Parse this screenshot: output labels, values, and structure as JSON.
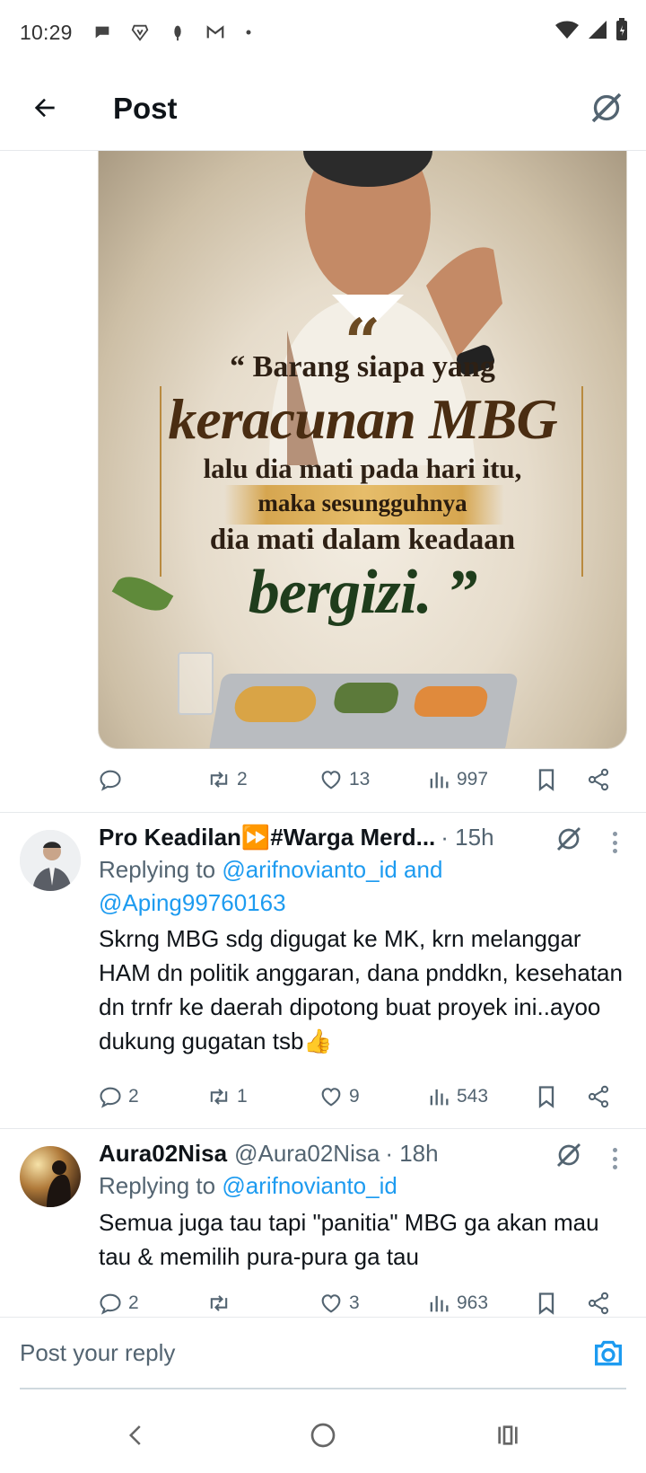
{
  "status_bar": {
    "time": "10:29",
    "icons_left": [
      "chat-icon",
      "brave-icon",
      "notification-icon",
      "gmail-icon",
      "dot-icon"
    ],
    "icons_right": [
      "wifi-icon",
      "signal-icon",
      "battery-icon"
    ]
  },
  "header": {
    "title": "Post",
    "back_icon": "arrow-left-icon",
    "grok_icon": "grok-icon"
  },
  "post": {
    "image_text": {
      "open_quote": "“",
      "line1": "“ Barang siapa yang",
      "line2": "keracunan MBG",
      "line3": "lalu dia mati pada hari itu,",
      "line4": "maka sesungguhnya",
      "line5": "dia mati dalam keadaan",
      "line6": "bergizi. ”"
    },
    "actions": {
      "replies": "",
      "reposts": "2",
      "likes": "13",
      "views": "997"
    }
  },
  "replies": [
    {
      "name": "Pro Keadilan⏩#Warga Merd...",
      "handle": "",
      "time": "· 15h",
      "replying_prefix": "Replying to ",
      "replying_to": "@arifnovianto_id and @Aping99760163",
      "text": "Skrng MBG sdg digugat ke MK, krn melanggar HAM dn politik anggaran, dana pnddkn, kesehatan dn trnfr ke daerah dipotong buat proyek ini..ayoo dukung gugatan tsb👍",
      "replies": "2",
      "reposts": "1",
      "likes": "9",
      "views": "543"
    },
    {
      "name": "Aura02Nisa",
      "handle": "@Aura02Nisa",
      "time": "· 18h",
      "replying_prefix": "Replying to ",
      "replying_to": "@arifnovianto_id",
      "text": "Semua juga tau tapi \"panitia\" MBG ga akan mau tau & memilih pura-pura ga tau",
      "replies": "2",
      "reposts": "",
      "likes": "3",
      "views": "963"
    }
  ],
  "composer": {
    "placeholder": "Post your reply",
    "camera_icon": "camera-icon"
  },
  "colors": {
    "accent": "#1d9bf0",
    "secondary_text": "#536471",
    "primary_text": "#0f1419"
  }
}
